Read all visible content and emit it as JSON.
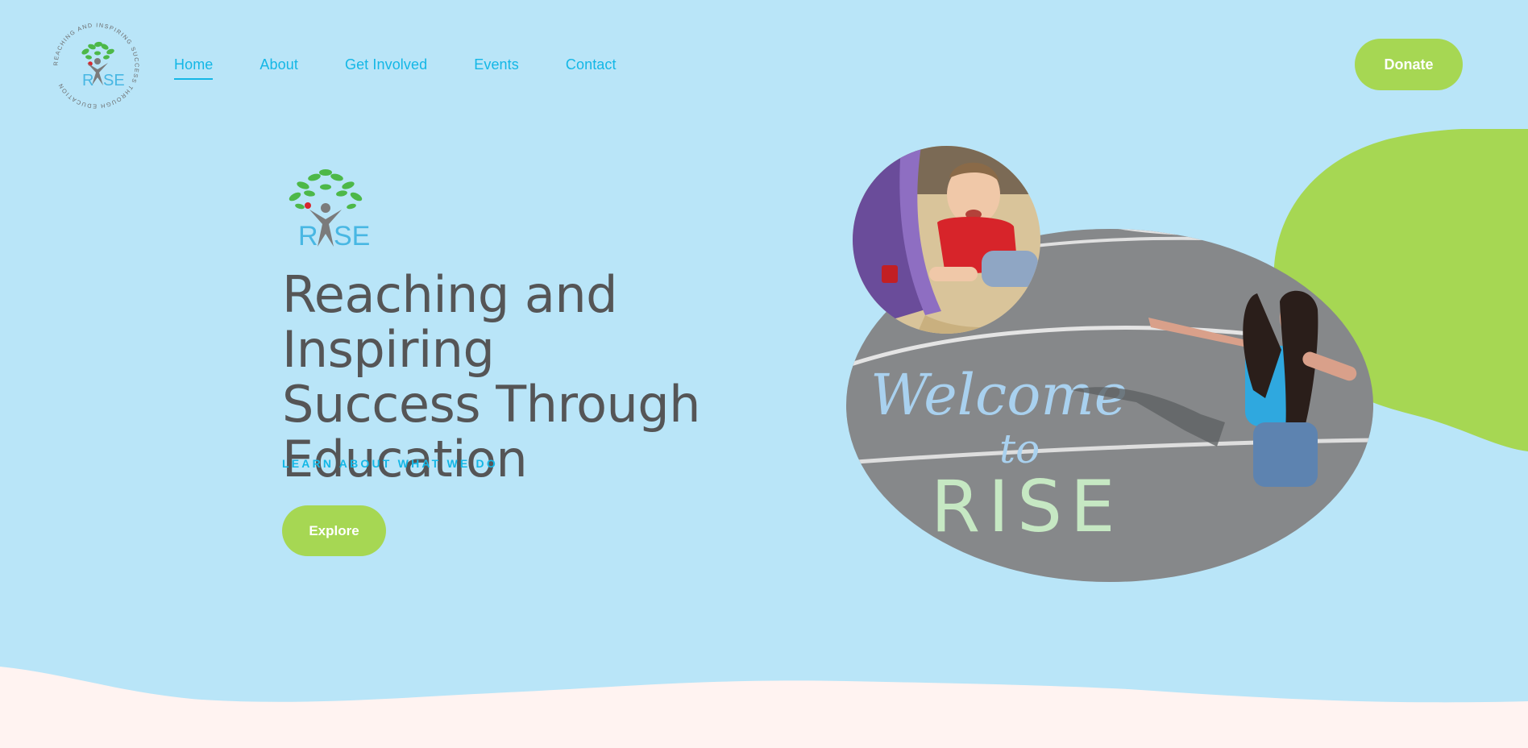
{
  "header": {
    "logo": {
      "brand": "RISE",
      "ring_text": "REACHING AND INSPIRING SUCCESS THROUGH EDUCATION",
      "icon": "tree-person-logo"
    },
    "nav": [
      {
        "label": "Home",
        "active": true
      },
      {
        "label": "About",
        "active": false
      },
      {
        "label": "Get Involved",
        "active": false
      },
      {
        "label": "Events",
        "active": false
      },
      {
        "label": "Contact",
        "active": false
      }
    ],
    "donate_label": "Donate"
  },
  "hero": {
    "logo_brand": "RISE",
    "headline": [
      "Reaching and Inspiring",
      "Success Through",
      "Education"
    ],
    "kicker": "LEARN ABOUT WHAT WE DO",
    "explore_label": "Explore",
    "chalk_text": [
      "Welcome",
      "to",
      "RISE"
    ]
  },
  "colors": {
    "background": "#b9e5f8",
    "accent_green": "#a6d753",
    "link_blue": "#14b7e6",
    "headline_gray": "#555556",
    "footer_wave": "#fff3f1"
  }
}
